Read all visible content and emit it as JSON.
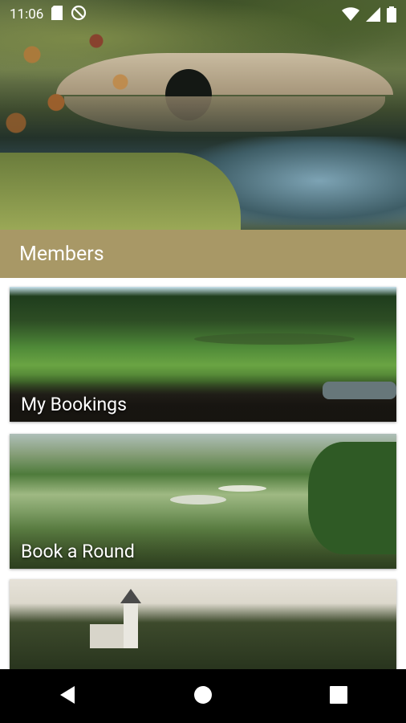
{
  "status_bar": {
    "time": "11:06",
    "icons": [
      "sd-card-icon",
      "do-not-disturb-icon",
      "wifi-icon",
      "signal-icon",
      "battery-icon"
    ]
  },
  "hero": {
    "image": "stone-bridge-over-pond"
  },
  "section": {
    "title": "Members"
  },
  "cards": [
    {
      "label": "My Bookings",
      "image": "golf-course-fairway"
    },
    {
      "label": "Book a Round",
      "image": "golf-course-green-with-bunkers"
    },
    {
      "label": "",
      "image": "clubhouse-tower-behind-trees"
    }
  ],
  "nav_bar": {
    "buttons": [
      "back-icon",
      "home-icon",
      "recents-icon"
    ]
  },
  "colors": {
    "header_bar": "#a89866",
    "nav_bar": "#000000"
  }
}
